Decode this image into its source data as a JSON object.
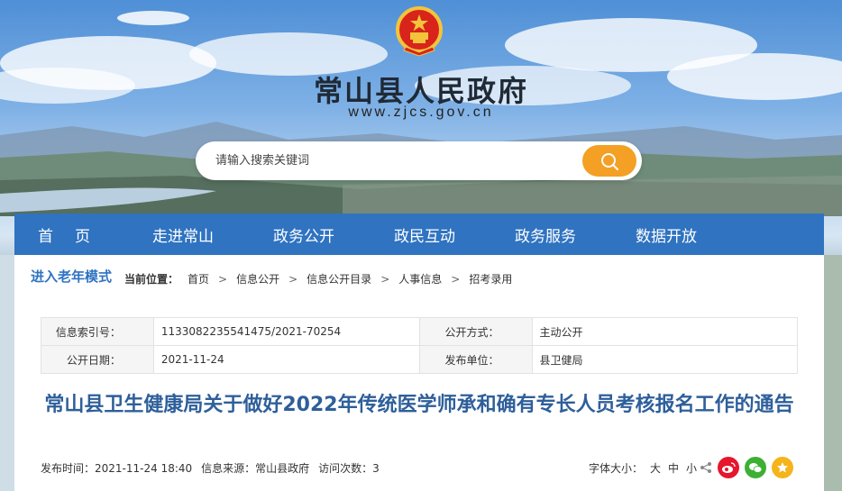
{
  "site": {
    "title": "常山县人民政府",
    "url": "www.zjcs.gov.cn"
  },
  "search": {
    "placeholder": "请输入搜索关键词",
    "button_icon": "search-icon"
  },
  "nav": {
    "items": [
      {
        "label": "首页"
      },
      {
        "label": "走进常山"
      },
      {
        "label": "政务公开"
      },
      {
        "label": "政民互动"
      },
      {
        "label": "政务服务"
      },
      {
        "label": "数据开放"
      }
    ]
  },
  "elder_mode": "进入老年模式",
  "breadcrumb": {
    "label": "当前位置：",
    "items": [
      "首页",
      "信息公开",
      "信息公开目录",
      "人事信息",
      "招考录用"
    ],
    "separator": ">"
  },
  "info": {
    "index_no_label": "信息索引号：",
    "index_no": "1133082235541475/2021-70254",
    "method_label": "公开方式：",
    "method": "主动公开",
    "date_label": "公开日期：",
    "date": "2021-11-24",
    "unit_label": "发布单位：",
    "unit": "县卫健局"
  },
  "article": {
    "title": "常山县卫生健康局关于做好2022年传统医学师承和确有专长人员考核报名工作的通告",
    "publish_time": "发布时间：2021-11-24 18:40",
    "source": "信息来源：常山县政府",
    "visits": "访问次数：3"
  },
  "font_size": {
    "label": "字体大小：",
    "large": "大",
    "medium": "中",
    "small": "小"
  },
  "colors": {
    "nav_bg": "#2f73c1",
    "accent": "#f4a024",
    "title": "#2e5f9a"
  }
}
